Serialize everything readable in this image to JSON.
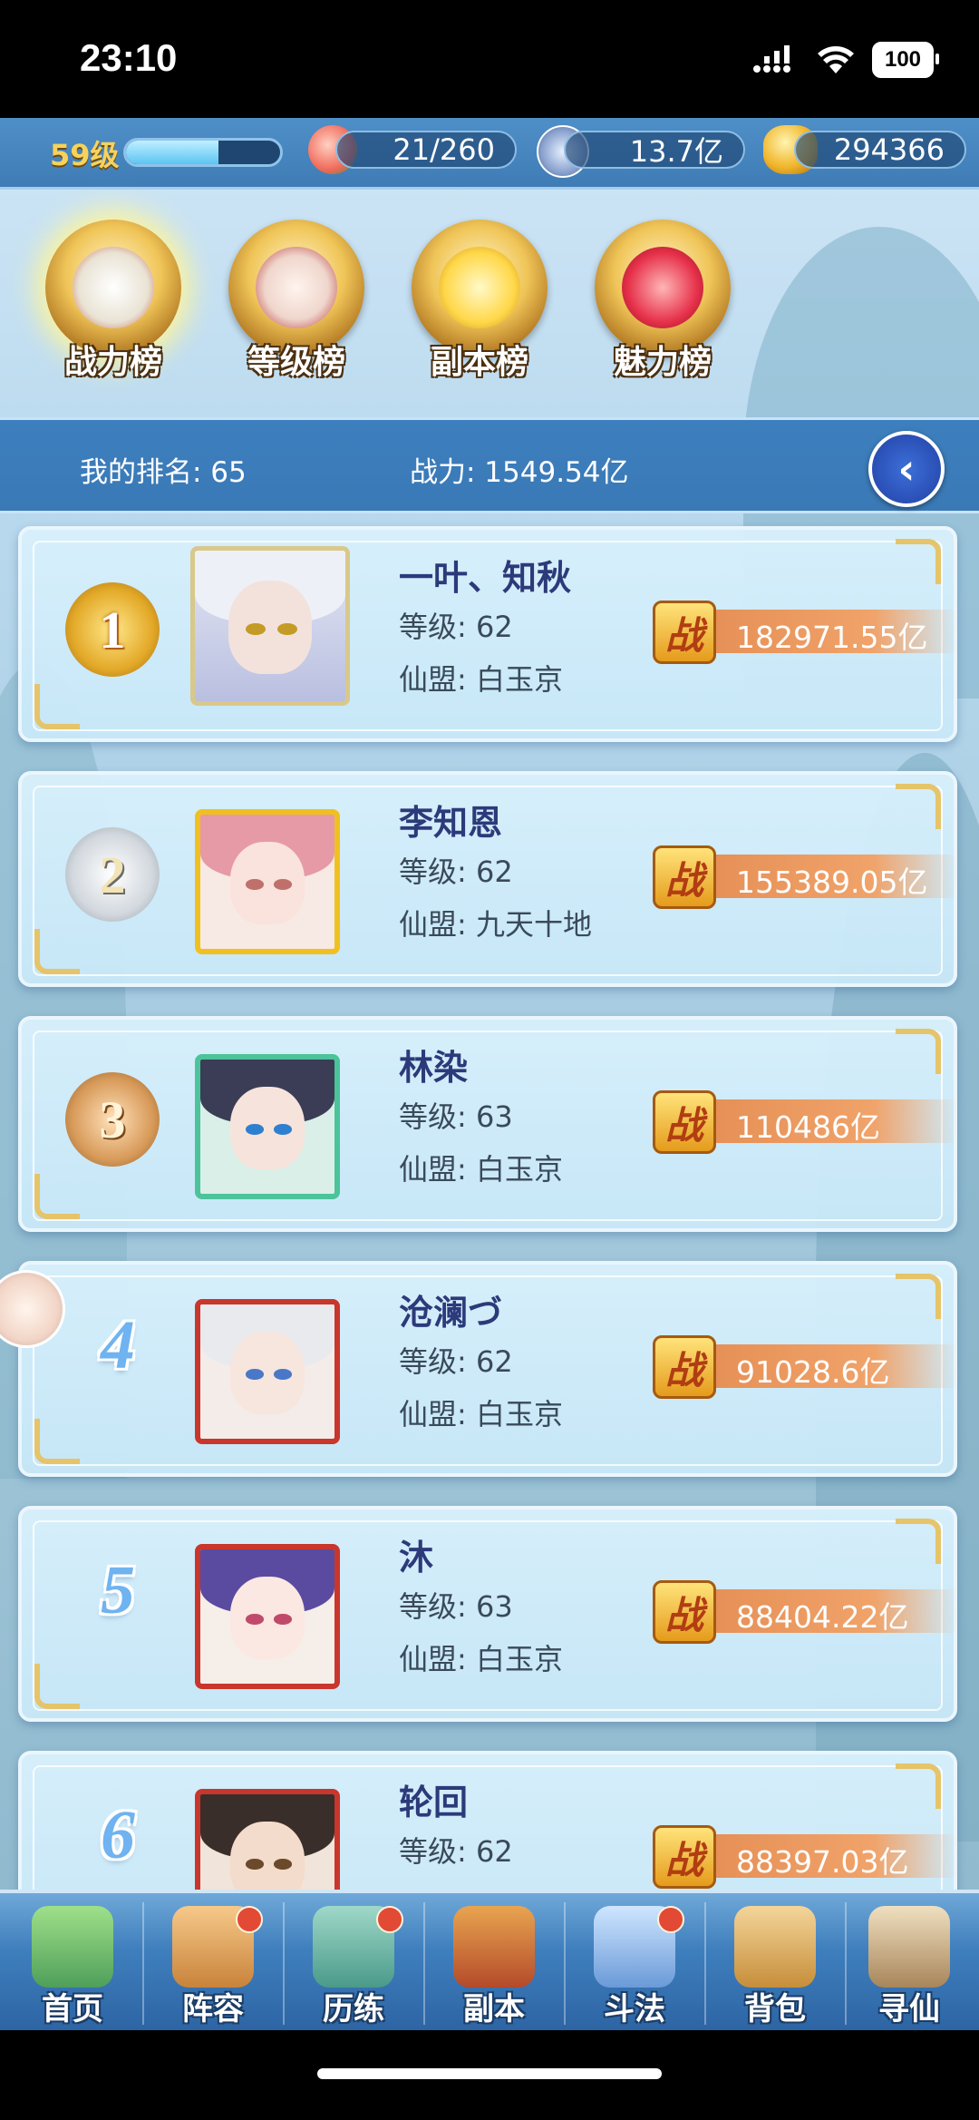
{
  "status_bar": {
    "time": "23:10",
    "battery": "100"
  },
  "resources": {
    "level": "59级",
    "xp_fraction": 0.6,
    "stamina": "21/260",
    "silver": "13.7亿",
    "gold": "294366"
  },
  "tabs": [
    {
      "label": "战力榜",
      "active": true
    },
    {
      "label": "等级榜",
      "active": false
    },
    {
      "label": "副本榜",
      "active": false
    },
    {
      "label": "魅力榜",
      "active": false
    }
  ],
  "my_rank": {
    "rank_text": "我的排名: 65",
    "power_text": "战力: 1549.54亿"
  },
  "power_badge": "战",
  "players": [
    {
      "rank": "1",
      "name": "一叶、知秋",
      "level": "等级: 62",
      "guild": "仙盟: 白玉京",
      "power": "182971.55亿"
    },
    {
      "rank": "2",
      "name": "李知恩",
      "level": "等级: 62",
      "guild": "仙盟: 九天十地",
      "power": "155389.05亿"
    },
    {
      "rank": "3",
      "name": "林染",
      "level": "等级: 63",
      "guild": "仙盟: 白玉京",
      "power": "110486亿"
    },
    {
      "rank": "4",
      "name": "沧澜づ",
      "level": "等级: 62",
      "guild": "仙盟: 白玉京",
      "power": "91028.6亿"
    },
    {
      "rank": "5",
      "name": "沐",
      "level": "等级: 63",
      "guild": "仙盟: 白玉京",
      "power": "88404.22亿"
    },
    {
      "rank": "6",
      "name": "轮回",
      "level": "等级: 62",
      "guild": "",
      "power": "88397.03亿"
    }
  ],
  "nav": [
    {
      "label": "首页",
      "dot": false
    },
    {
      "label": "阵容",
      "dot": true
    },
    {
      "label": "历练",
      "dot": true
    },
    {
      "label": "副本",
      "dot": false
    },
    {
      "label": "斗法",
      "dot": true
    },
    {
      "label": "背包",
      "dot": false
    },
    {
      "label": "寻仙",
      "dot": false
    }
  ]
}
